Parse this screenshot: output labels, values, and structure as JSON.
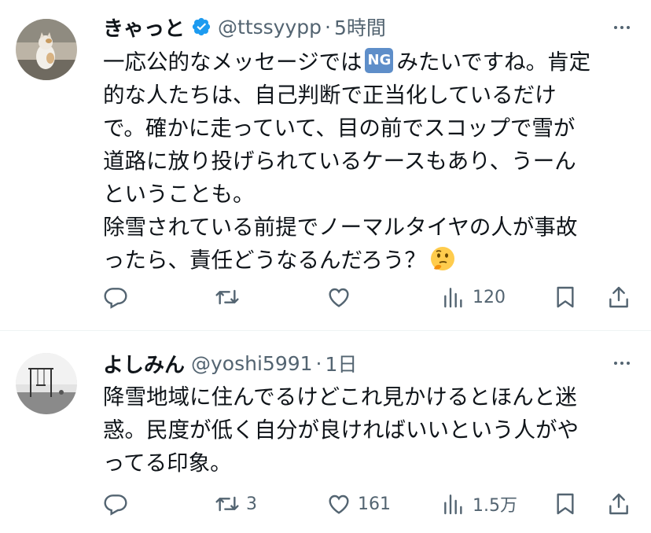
{
  "colors": {
    "text": "#0f1419",
    "secondary": "#536471",
    "verified": "#1d9bf0",
    "divider": "#eff3f4"
  },
  "tweets": [
    {
      "author_name": "きゃっと",
      "verified": true,
      "handle": "@ttssyypp",
      "separator": "·",
      "time": "5時間",
      "badge": "NG",
      "lines": [
        [
          "一応公的なメッセージでは",
          "みたいですね。肯定"
        ],
        [
          "的な人たちは、自己判断で正当化しているだけ"
        ],
        [
          "で。確かに走っていて、目の前でスコップで雪が"
        ],
        [
          "道路に放り投げられているケースもあり、うーん"
        ],
        [
          "ということも。"
        ],
        [
          "除雪されている前提でノーマルタイヤの人が事故"
        ],
        [
          "ったら、責任どうなるんだろう？"
        ]
      ],
      "emoji": "thinking-face",
      "actions": {
        "reply": "",
        "retweet": "",
        "like": "",
        "views": "120"
      }
    },
    {
      "author_name": "よしみん",
      "verified": false,
      "handle": "@yoshi5991",
      "separator": "·",
      "time": "1日",
      "lines": [
        [
          "降雪地域に住んでるけどこれ見かけるとほんと迷"
        ],
        [
          "惑。民度が低く自分が良ければいいという人がや"
        ],
        [
          "ってる印象。"
        ]
      ],
      "actions": {
        "reply": "",
        "retweet": "3",
        "like": "161",
        "views": "1.5万"
      }
    }
  ]
}
